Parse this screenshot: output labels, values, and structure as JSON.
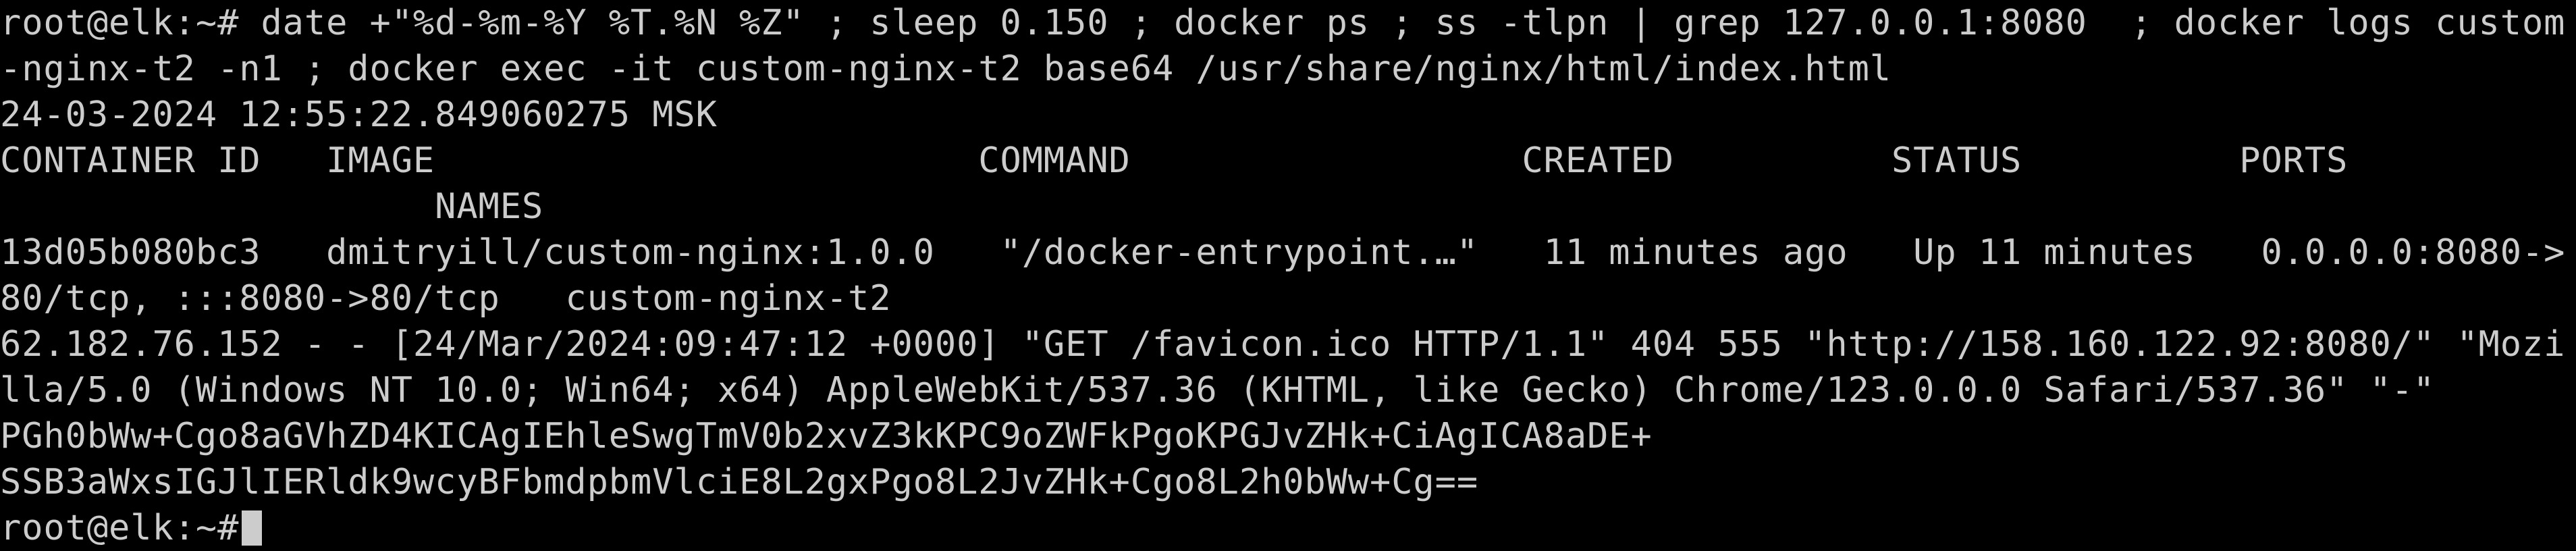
{
  "terminal": {
    "lines": [
      "root@elk:~# date +\"%d-%m-%Y %T.%N %Z\" ; sleep 0.150 ; docker ps ; ss -tlpn | grep 127.0.0.1:8080  ; docker logs custom",
      "-nginx-t2 -n1 ; docker exec -it custom-nginx-t2 base64 /usr/share/nginx/html/index.html",
      "24-03-2024 12:55:22.849060275 MSK",
      "CONTAINER ID   IMAGE                         COMMAND                  CREATED          STATUS          PORTS",
      "                    NAMES",
      "13d05b080bc3   dmitryill/custom-nginx:1.0.0   \"/docker-entrypoint.…\"   11 minutes ago   Up 11 minutes   0.0.0.0:8080->",
      "80/tcp, :::8080->80/tcp   custom-nginx-t2",
      "62.182.76.152 - - [24/Mar/2024:09:47:12 +0000] \"GET /favicon.ico HTTP/1.1\" 404 555 \"http://158.160.122.92:8080/\" \"Mozi",
      "lla/5.0 (Windows NT 10.0; Win64; x64) AppleWebKit/537.36 (KHTML, like Gecko) Chrome/123.0.0.0 Safari/537.36\" \"-\"",
      "PGh0bWw+Cgo8aGVhZD4KICAgIEhleSwgTmV0b2xvZ3kKPC9oZWFkPgoKPGJvZHk+CiAgICA8aDE+",
      "SSB3aWxsIGJlIERldk9wcyBFbmdpbmVlciE8L2gxPgo8L2JvZHk+Cgo8L2h0bWw+Cg=="
    ],
    "prompt": "root@elk:~#"
  }
}
